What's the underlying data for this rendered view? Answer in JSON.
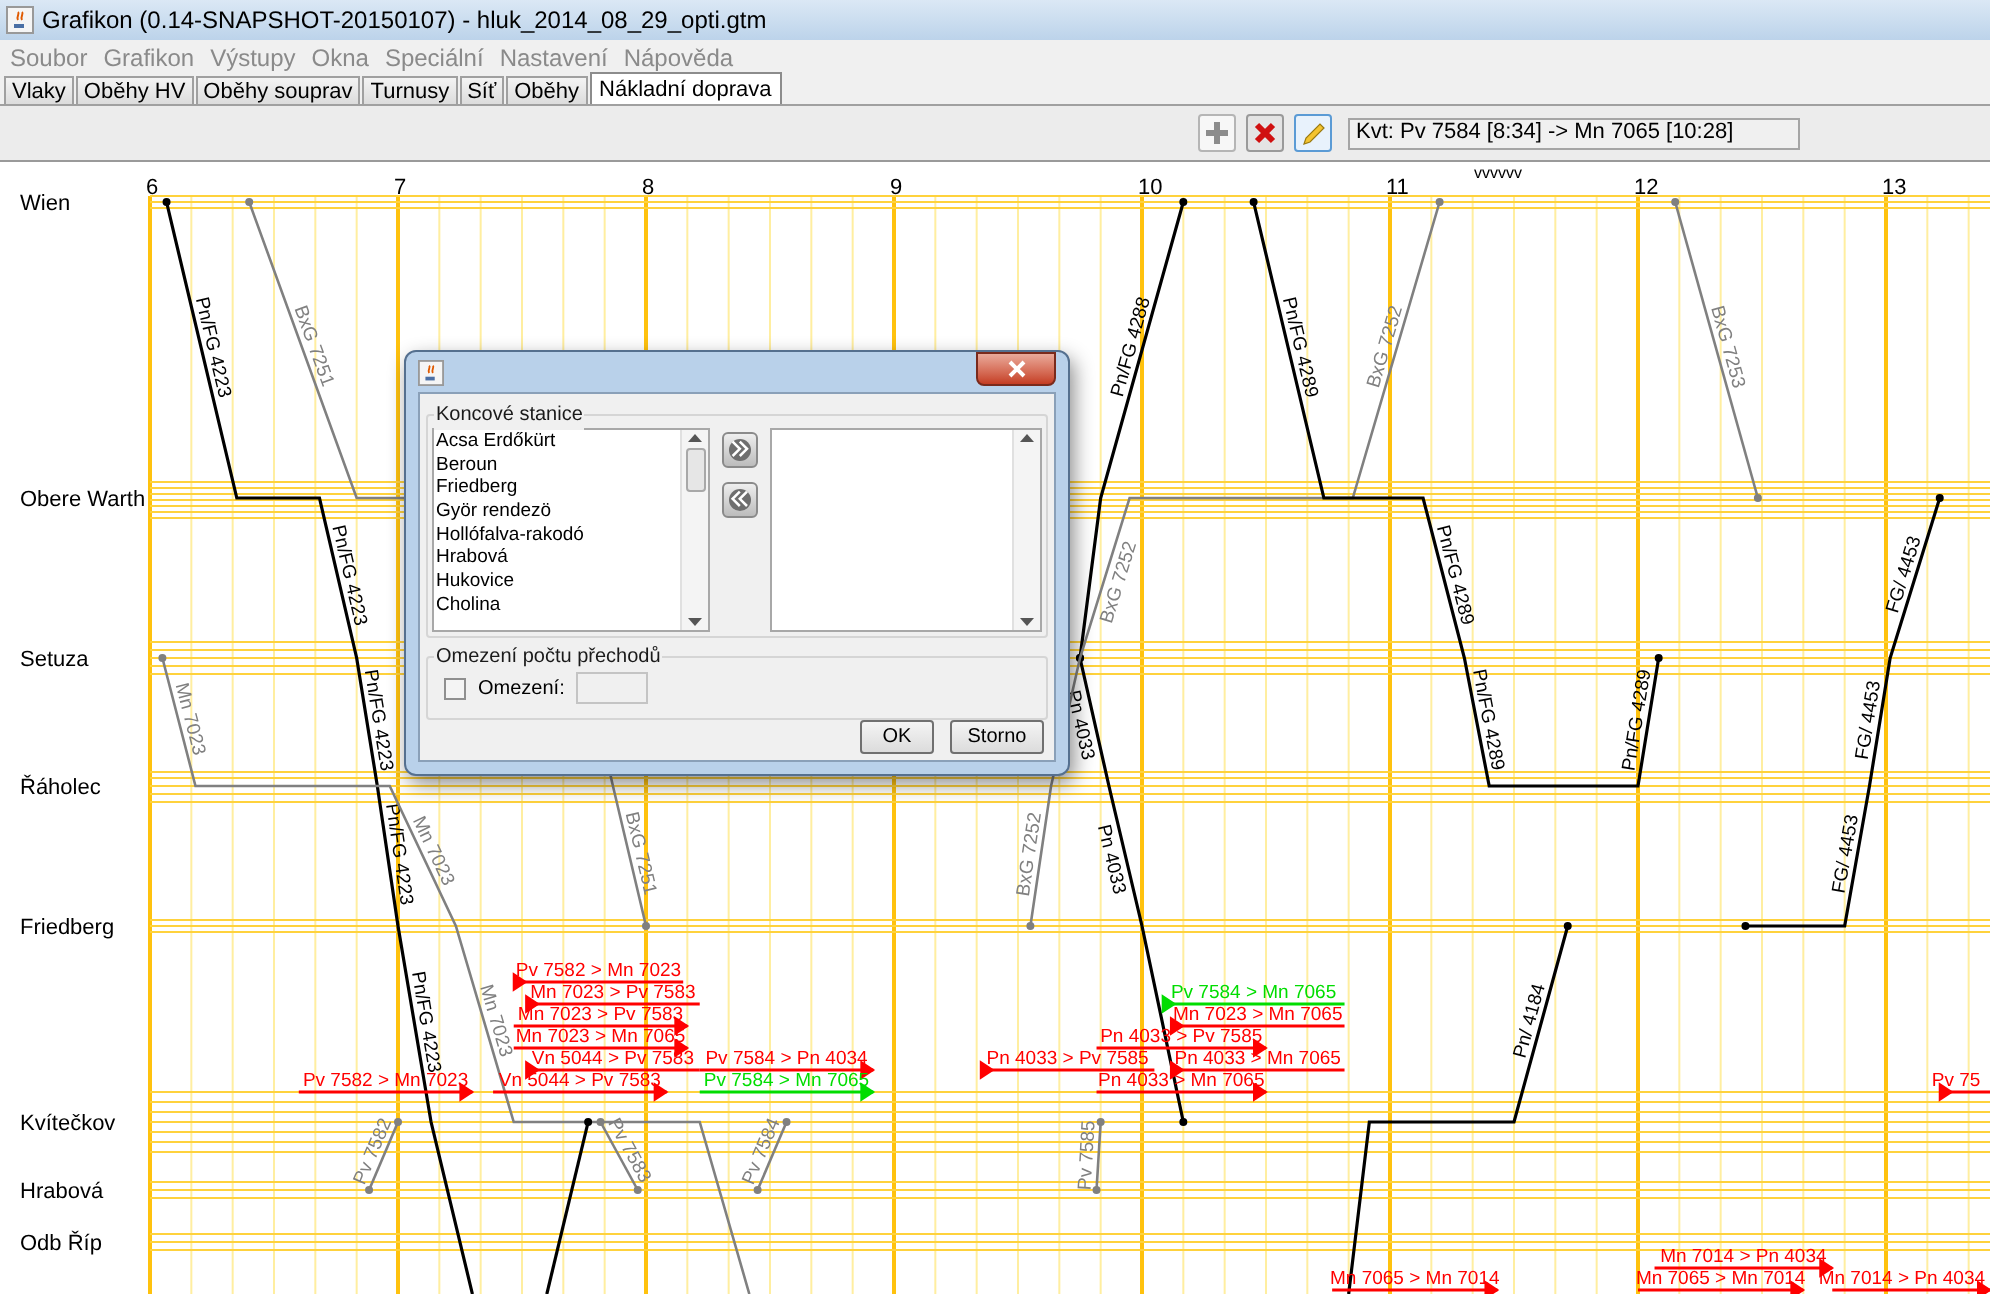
{
  "window": {
    "title": "Grafikon (0.14-SNAPSHOT-20150107) - hluk_2014_08_29_opti.gtm"
  },
  "menu": [
    {
      "label": "Soubor",
      "disabled": true
    },
    {
      "label": "Grafikon",
      "disabled": true
    },
    {
      "label": "Výstupy",
      "disabled": true
    },
    {
      "label": "Okna",
      "disabled": true
    },
    {
      "label": "Speciální",
      "disabled": true
    },
    {
      "label": "Nastavení",
      "disabled": true
    },
    {
      "label": "Nápověda",
      "disabled": true
    }
  ],
  "tabs": [
    {
      "label": "Vlaky",
      "selected": false
    },
    {
      "label": "Oběhy HV",
      "selected": false
    },
    {
      "label": "Oběhy souprav",
      "selected": false
    },
    {
      "label": "Turnusy",
      "selected": false
    },
    {
      "label": "Síť",
      "selected": false
    },
    {
      "label": "Oběhy",
      "selected": false
    },
    {
      "label": "Nákladní doprava",
      "selected": true
    }
  ],
  "toolbar": {
    "buttons": [
      {
        "kind": "add"
      },
      {
        "kind": "delete"
      },
      {
        "kind": "edit"
      }
    ],
    "field_value": "Kvt: Pv 7584 [8:34] -> Mn 7065 [10:28]"
  },
  "graph": {
    "marker": "vvvvvv",
    "hours": [
      "6",
      "7",
      "8",
      "9",
      "10",
      "11",
      "12",
      "13"
    ],
    "stations": [
      "Wien",
      "Obere Warth",
      "Setuza",
      "Řáholec",
      "Friedberg",
      "Kvítečkov",
      "Hrabová",
      "Odb Říp"
    ],
    "trains": [
      {
        "color": "#000000",
        "labels": [
          "Pn/FG 4223",
          "Pn/FG 4223",
          "Pn/FG 4223",
          "Pn/FG 4223",
          "Pn/FG 4223"
        ]
      },
      {
        "color": "#808080",
        "labels": [
          "BxG 7251",
          "BxG 7251"
        ]
      },
      {
        "color": "#808080",
        "labels": [
          "Mn 7023",
          "Mn 7023",
          "Mn 7023"
        ]
      },
      {
        "color": "#000000",
        "labels": [
          "Pn/FG 4288"
        ]
      },
      {
        "color": "#000000",
        "labels": [
          "Pn 4033",
          "Pn 4033"
        ]
      },
      {
        "color": "#808080",
        "labels": [
          "BxG 7252",
          "BxG 7252",
          "BxG 7252"
        ]
      },
      {
        "color": "#000000",
        "labels": [
          "Pn/FG 4289",
          "Pn/FG 4289",
          "Pn/FG 4289",
          "Pn/FG 4289"
        ]
      },
      {
        "color": "#808080",
        "labels": [
          "BxG 7253"
        ]
      },
      {
        "color": "#000000",
        "labels": [
          "FG/ 4453",
          "FG/ 4453",
          "FG/ 4453"
        ]
      },
      {
        "color": "#000000",
        "labels": [
          "Pn/ 4184"
        ]
      },
      {
        "color": "#000000"
      },
      {
        "color": "#808080",
        "labels": [
          "Pv 7582"
        ]
      },
      {
        "color": "#808080",
        "labels": [
          "Pv 7583"
        ]
      },
      {
        "color": "#808080",
        "labels": [
          "Pv 7584"
        ]
      },
      {
        "color": "#808080",
        "labels": [
          "Pv 7585"
        ]
      }
    ],
    "connections": [
      {
        "text": "Pv 7582 > Mn 7023",
        "color": "#ff0000",
        "kind": "start"
      },
      {
        "text": "Mn 7023 > Pv 7583",
        "color": "#ff0000",
        "kind": "start"
      },
      {
        "text": "Mn 7023 > Pv 7583",
        "color": "#ff0000",
        "kind": "end"
      },
      {
        "text": "Mn 7023 > Mn 7065",
        "color": "#ff0000",
        "kind": "end"
      },
      {
        "text": "Vn 5044 > Pv 7583",
        "color": "#ff0000",
        "kind": "start"
      },
      {
        "text": "Pv 7584 > Pn 4034",
        "color": "#ff0000",
        "kind": "end"
      },
      {
        "text": "Pv 7582 > Mn 7023",
        "color": "#ff0000",
        "kind": "end"
      },
      {
        "text": "Vn 5044 > Pv 7583",
        "color": "#ff0000",
        "kind": "end"
      },
      {
        "text": "Pv 7584 > Mn 7065",
        "color": "#00dd00",
        "kind": "end"
      },
      {
        "text": "Pv 7584 > Mn 7065",
        "color": "#00dd00",
        "kind": "start"
      },
      {
        "text": "Mn 7023 > Mn 7065",
        "color": "#ff0000",
        "kind": "start"
      },
      {
        "text": "Pn 4033 > Pv 7585",
        "color": "#ff0000",
        "kind": "end"
      },
      {
        "text": "Pn 4033 > Pv 7585",
        "color": "#ff0000",
        "kind": "start"
      },
      {
        "text": "Pn 4033 > Mn 7065",
        "color": "#ff0000",
        "kind": "start"
      },
      {
        "text": "Pn 4033 > Mn 7065",
        "color": "#ff0000",
        "kind": "end"
      },
      {
        "text": "Pv 75",
        "color": "#ff0000",
        "kind": "start"
      },
      {
        "text": "Mn 7014 > Pn 4034",
        "color": "#ff0000",
        "kind": "end"
      },
      {
        "text": "Mn 7065 > Mn 7014",
        "color": "#ff0000",
        "kind": "end"
      },
      {
        "text": "Mn 7065 > Mn 7014",
        "color": "#ff0000",
        "kind": "end"
      },
      {
        "text": "Mn 7014 > Pn 4034",
        "color": "#ff0000",
        "kind": "end"
      }
    ]
  },
  "dialog": {
    "stations_group": {
      "title": "Koncové stanice",
      "items": [
        {
          "label": "Acsa Erdőkürt",
          "selected": false
        },
        {
          "label": "Beroun",
          "selected": false
        },
        {
          "label": "Friedberg",
          "selected": false
        },
        {
          "label": "Györ rendezö",
          "selected": false
        },
        {
          "label": "Hollófalva-rakodó",
          "selected": false
        },
        {
          "label": "Hrabová",
          "selected": false
        },
        {
          "label": "Hukovice",
          "selected": false
        },
        {
          "label": "Cholina",
          "selected": false
        }
      ]
    },
    "limit_group": {
      "title": "Omezení počtu přechodů",
      "checkbox_label": "Omezení:",
      "checked": false,
      "field_disabled": true
    },
    "buttons": [
      "OK",
      "Storno"
    ]
  }
}
